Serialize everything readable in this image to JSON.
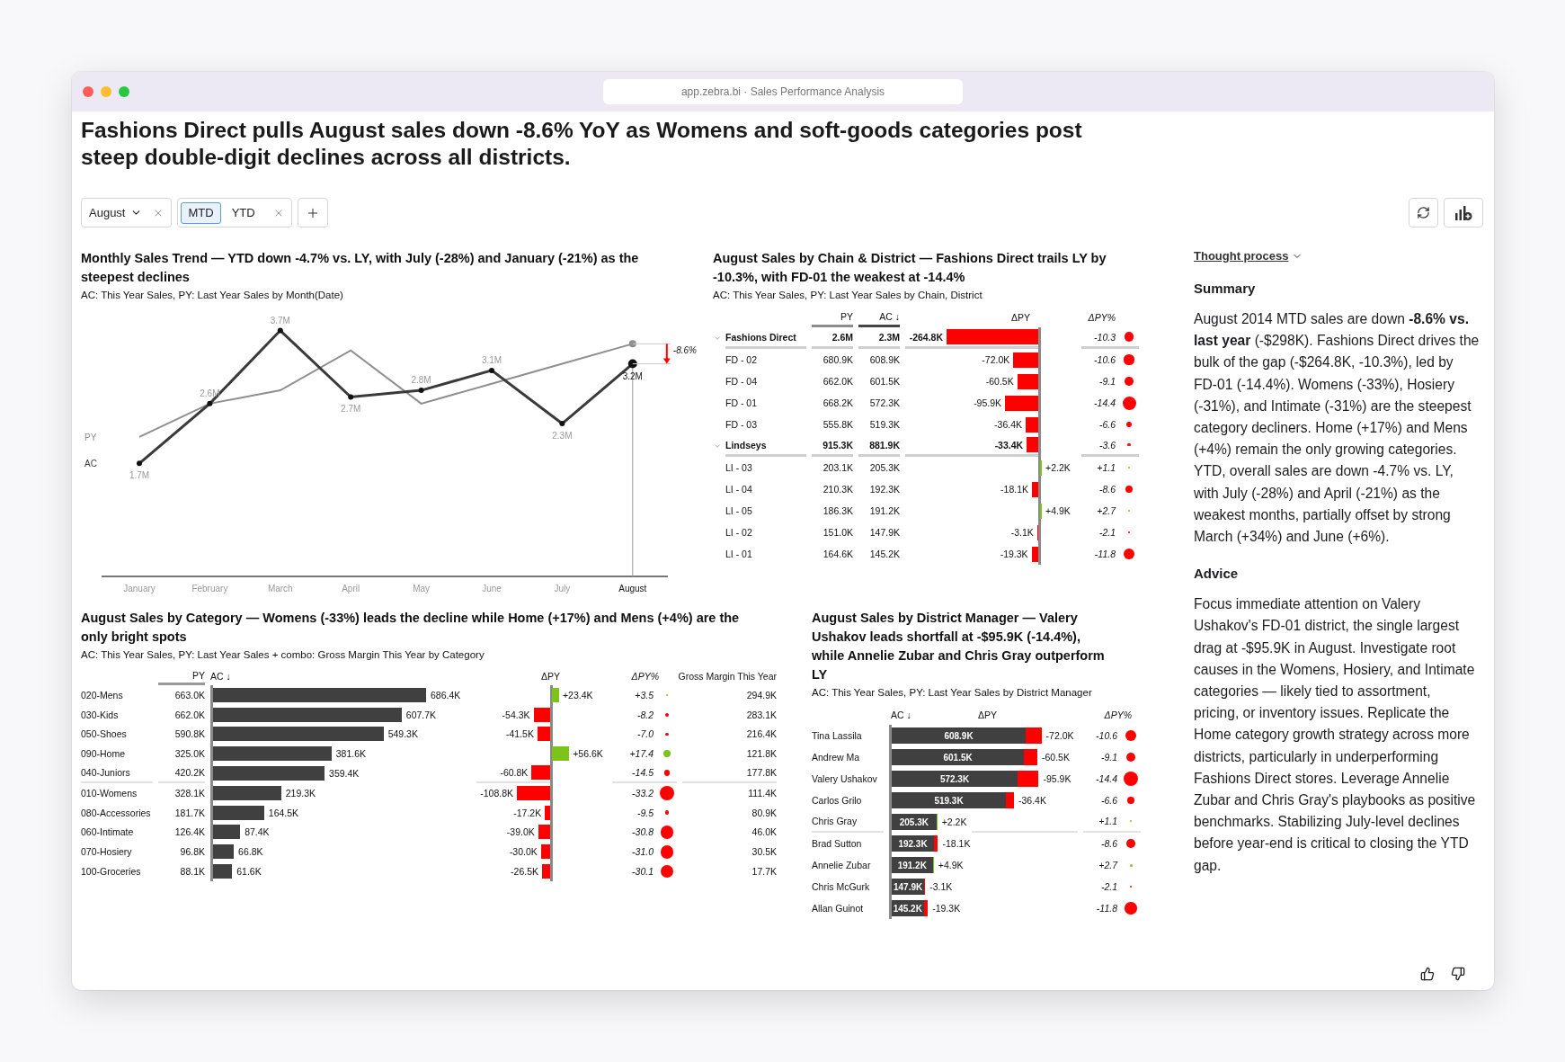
{
  "window": {
    "url": "app.zebra.bi · Sales Performance Analysis"
  },
  "headline": "Fashions Direct pulls August sales down -8.6% YoY as Womens and soft-goods categories post steep double-digit declines across all districts.",
  "filters": {
    "month": "August",
    "periods": [
      {
        "label": "MTD",
        "selected": true
      },
      {
        "label": "YTD",
        "selected": false
      }
    ]
  },
  "trend": {
    "title": "Monthly Sales Trend — YTD down -4.7% vs. LY, with July (-28%) and January (-21%) as the steepest declines",
    "subtitle": "AC: This Year Sales, PY: Last Year Sales by Month(Date)",
    "chart_data": {
      "type": "line",
      "categories": [
        "January",
        "February",
        "March",
        "April",
        "May",
        "June",
        "July",
        "August"
      ],
      "series": [
        {
          "name": "AC",
          "color": "#3a3a3a",
          "marker": true,
          "values": [
            1.7,
            2.6,
            3.7,
            2.7,
            2.8,
            3.1,
            2.3,
            3.2
          ],
          "value_labels": [
            "1.7M",
            "2.6M",
            "3.7M",
            "2.7M",
            "2.8M",
            "3.1M",
            "2.3M",
            "3.2M"
          ]
        },
        {
          "name": "PY",
          "color": "#8f8f8f",
          "values": [
            2.1,
            2.6,
            2.8,
            3.4,
            2.6,
            2.9,
            3.2,
            3.5
          ],
          "value_labels": [
            null,
            null,
            null,
            null,
            null,
            null,
            null,
            null
          ]
        }
      ],
      "annotations": [
        {
          "text": "-8.6%"
        }
      ]
    }
  },
  "chain_table": {
    "title": "August Sales by Chain & District — Fashions Direct trails LY by -10.3%, with FD-01 the weakest at -14.4%",
    "subtitle": "AC: This Year Sales, PY: Last Year Sales by Chain, District",
    "columns": [
      "PY",
      "AC ↓",
      "ΔPY",
      "ΔPY%"
    ],
    "rows": [
      {
        "kind": "group",
        "expanded": true,
        "name": "Fashions Direct",
        "py": "2.6M",
        "ac": "2.3M",
        "delta": "-264.8K",
        "delta_pct": "-10.3"
      },
      {
        "kind": "item",
        "name": "FD - 02",
        "py": "680.9K",
        "ac": "608.9K",
        "delta": "-72.0K",
        "delta_pct": "-10.6"
      },
      {
        "kind": "item",
        "name": "FD - 04",
        "py": "662.0K",
        "ac": "601.5K",
        "delta": "-60.5K",
        "delta_pct": "-9.1"
      },
      {
        "kind": "item",
        "name": "FD - 01",
        "py": "668.2K",
        "ac": "572.3K",
        "delta": "-95.9K",
        "delta_pct": "-14.4"
      },
      {
        "kind": "item",
        "name": "FD - 03",
        "py": "555.8K",
        "ac": "519.3K",
        "delta": "-36.4K",
        "delta_pct": "-6.6"
      },
      {
        "kind": "group",
        "expanded": true,
        "name": "Lindseys",
        "py": "915.3K",
        "ac": "881.9K",
        "delta": "-33.4K",
        "delta_pct": "-3.6"
      },
      {
        "kind": "item",
        "name": "LI - 03",
        "py": "203.1K",
        "ac": "205.3K",
        "delta": "+2.2K",
        "delta_pct": "+1.1"
      },
      {
        "kind": "item",
        "name": "LI - 04",
        "py": "210.3K",
        "ac": "192.3K",
        "delta": "-18.1K",
        "delta_pct": "-8.6"
      },
      {
        "kind": "item",
        "name": "LI - 05",
        "py": "186.3K",
        "ac": "191.2K",
        "delta": "+4.9K",
        "delta_pct": "+2.7"
      },
      {
        "kind": "item",
        "name": "LI - 02",
        "py": "151.0K",
        "ac": "147.9K",
        "delta": "-3.1K",
        "delta_pct": "-2.1"
      },
      {
        "kind": "item",
        "name": "LI - 01",
        "py": "164.6K",
        "ac": "145.2K",
        "delta": "-19.3K",
        "delta_pct": "-11.8"
      }
    ]
  },
  "category_table": {
    "title": "August Sales by Category — Womens (-33%) leads the decline while Home (+17%) and Mens (+4%) are the only bright spots",
    "subtitle": "AC: This Year Sales, PY: Last Year Sales + combo: Gross Margin This Year by Category",
    "columns": [
      "PY",
      "AC ↓",
      "ΔPY",
      "ΔPY%",
      "Gross Margin This Year"
    ],
    "rows": [
      {
        "name": "020-Mens",
        "py": "663.0K",
        "ac": "686.4K",
        "delta": "+23.4K",
        "delta_pct": "+3.5",
        "margin": "294.9K",
        "separator": false
      },
      {
        "name": "030-Kids",
        "py": "662.0K",
        "ac": "607.7K",
        "delta": "-54.3K",
        "delta_pct": "-8.2",
        "margin": "283.1K",
        "separator": false
      },
      {
        "name": "050-Shoes",
        "py": "590.8K",
        "ac": "549.3K",
        "delta": "-41.5K",
        "delta_pct": "-7.0",
        "margin": "216.4K",
        "separator": false
      },
      {
        "name": "090-Home",
        "py": "325.0K",
        "ac": "381.6K",
        "delta": "+56.6K",
        "delta_pct": "+17.4",
        "margin": "121.8K",
        "separator": false
      },
      {
        "name": "040-Juniors",
        "py": "420.2K",
        "ac": "359.4K",
        "delta": "-60.8K",
        "delta_pct": "-14.5",
        "margin": "177.8K",
        "separator": true
      },
      {
        "name": "010-Womens",
        "py": "328.1K",
        "ac": "219.3K",
        "delta": "-108.8K",
        "delta_pct": "-33.2",
        "margin": "111.4K",
        "separator": false
      },
      {
        "name": "080-Accessories",
        "py": "181.7K",
        "ac": "164.5K",
        "delta": "-17.2K",
        "delta_pct": "-9.5",
        "margin": "80.9K",
        "separator": false
      },
      {
        "name": "060-Intimate",
        "py": "126.4K",
        "ac": "87.4K",
        "delta": "-39.0K",
        "delta_pct": "-30.8",
        "margin": "46.0K",
        "separator": false
      },
      {
        "name": "070-Hosiery",
        "py": "96.8K",
        "ac": "66.8K",
        "delta": "-30.0K",
        "delta_pct": "-31.0",
        "margin": "30.5K",
        "separator": false
      },
      {
        "name": "100-Groceries",
        "py": "88.1K",
        "ac": "61.6K",
        "delta": "-26.5K",
        "delta_pct": "-30.1",
        "margin": "17.7K",
        "separator": false
      }
    ]
  },
  "manager_table": {
    "title": "August Sales by District Manager — Valery Ushakov leads shortfall at -$95.9K (-14.4%), while Annelie Zubar and Chris Gray outperform LY",
    "subtitle": "AC: This Year Sales, PY: Last Year Sales by District Manager",
    "columns": [
      "AC ↓",
      "ΔPY",
      "ΔPY%"
    ],
    "rows": [
      {
        "name": "Tina Lassila",
        "ac": "608.9K",
        "delta": "-72.0K",
        "delta_pct": "-10.6",
        "separator": false
      },
      {
        "name": "Andrew Ma",
        "ac": "601.5K",
        "delta": "-60.5K",
        "delta_pct": "-9.1",
        "separator": false
      },
      {
        "name": "Valery Ushakov",
        "ac": "572.3K",
        "delta": "-95.9K",
        "delta_pct": "-14.4",
        "separator": false
      },
      {
        "name": "Carlos Grilo",
        "ac": "519.3K",
        "delta": "-36.4K",
        "delta_pct": "-6.6",
        "separator": false
      },
      {
        "name": "Chris Gray",
        "ac": "205.3K",
        "delta": "+2.2K",
        "delta_pct": "+1.1",
        "separator": true
      },
      {
        "name": "Brad Sutton",
        "ac": "192.3K",
        "delta": "-18.1K",
        "delta_pct": "-8.6",
        "separator": false
      },
      {
        "name": "Annelie Zubar",
        "ac": "191.2K",
        "delta": "+4.9K",
        "delta_pct": "+2.7",
        "separator": false
      },
      {
        "name": "Chris McGurk",
        "ac": "147.9K",
        "delta": "-3.1K",
        "delta_pct": "-2.1",
        "separator": false
      },
      {
        "name": "Allan Guinot",
        "ac": "145.2K",
        "delta": "-19.3K",
        "delta_pct": "-11.8",
        "separator": false
      }
    ]
  },
  "insights": {
    "thought_process": "Thought process",
    "sections": [
      {
        "heading": "Summary",
        "text": "August 2014 MTD sales are down **-8.6% vs. last year** (-$298K). Fashions Direct drives the bulk of the gap (-$264.8K, -10.3%), led by FD-01 (-14.4%). Womens (-33%), Hosiery (-31%), and Intimate (-31%) are the steepest category decliners. Home (+17%) and Mens (+4%) remain the only growing categories. YTD, overall sales are down -4.7% vs. LY, with July (-28%) and April (-21%) as the weakest months, partially offset by strong March (+34%) and June (+6%)."
      },
      {
        "heading": "Advice",
        "text": "Focus immediate attention on Valery Ushakov's FD-01 district, the single largest drag at -$95.9K in August. Investigate root causes in the Womens, Hosiery, and Intimate categories — likely tied to assortment, pricing, or inventory issues. Replicate the Home category growth strategy across more districts, particularly in underperforming Fashions Direct stores. Leverage Annelie Zubar and Chris Gray's playbooks as positive benchmarks. Stabilizing July-level declines before year-end is critical to closing the YTD gap."
      }
    ]
  }
}
